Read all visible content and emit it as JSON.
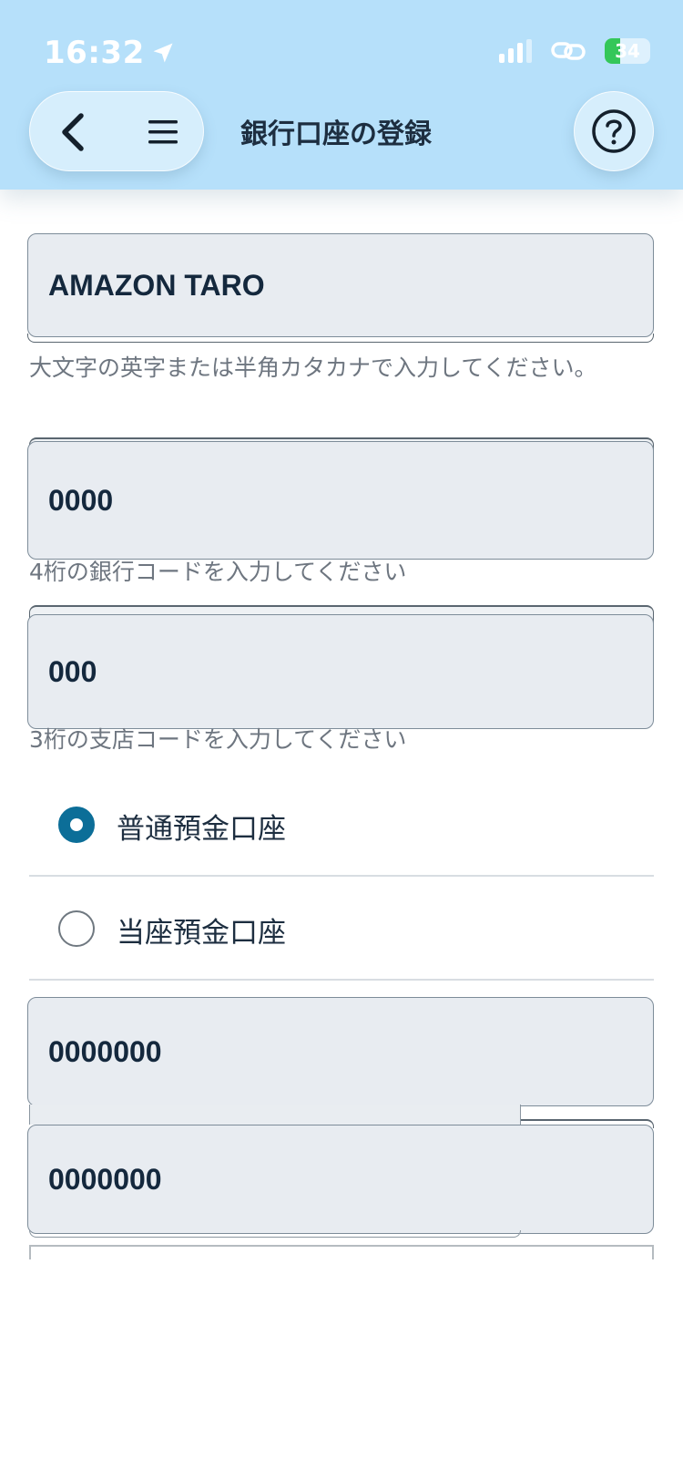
{
  "status_bar": {
    "time": "16:32",
    "battery": "34",
    "battery_level": 0.34
  },
  "header": {
    "title": "銀行口座の登録"
  },
  "icons": {
    "back": "chevron-left-icon",
    "menu": "hamburger-icon",
    "help": "question-circle-icon",
    "location": "location-arrow-icon",
    "link": "link-icon"
  },
  "form": {
    "account_holder": {
      "value": "AMAZON TARO",
      "hint": "大文字の英字または半角カタカナで入力してください。"
    },
    "bank_code": {
      "value": "0000",
      "hint": "4桁の銀行コードを入力してください"
    },
    "branch_code": {
      "value": "000",
      "hint": "3桁の支店コードを入力してください"
    },
    "account_types": [
      {
        "label": "普通預金口座",
        "selected": true
      },
      {
        "label": "当座預金口座",
        "selected": false
      }
    ],
    "account_number": {
      "value": "0000000"
    },
    "account_number_confirm": {
      "value": "0000000"
    }
  },
  "colors": {
    "header_bg": "#b6e0fa",
    "accent": "#0c6e98",
    "field_bg": "#e8ecf1"
  }
}
